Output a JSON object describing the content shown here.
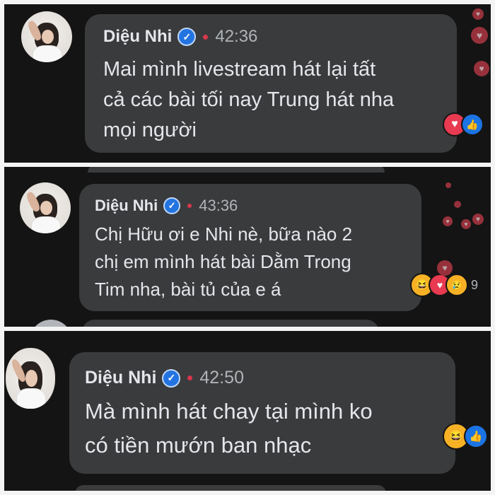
{
  "comments": [
    {
      "name": "Diệu Nhi",
      "verified_icon": "verified-badge-icon",
      "time": "42:36",
      "lines": [
        "Mai mình livestream hát lại tất",
        "cả các bài tối nay Trung hát nha",
        "mọi người"
      ],
      "reactions": [
        "love",
        "like"
      ]
    },
    {
      "name": "Diệu Nhi",
      "verified_icon": "verified-badge-icon",
      "time": "43:36",
      "lines": [
        "Chị Hữu ơi e Nhi nè, bữa nào 2",
        "chị em mình hát bài Dằm Trong",
        "Tim nha, bài tủ của e á"
      ],
      "reactions": [
        "haha",
        "love",
        "sad"
      ],
      "reaction_count": "9"
    },
    {
      "name": "Diệu Nhi",
      "verified_icon": "verified-badge-icon",
      "time": "42:50",
      "lines": [
        "Mà mình hát chay tại mình ko",
        "có tiền mướn ban nhạc"
      ],
      "reactions": [
        "haha",
        "like"
      ]
    }
  ],
  "colors": {
    "background": "#141414",
    "bubble": "#3a3b3c",
    "text": "#e4e6eb",
    "meta": "#b0b3b8",
    "verified": "#2374e1",
    "live_dot": "#d9364c",
    "love": "#e83a50",
    "like": "#1b74e4",
    "haha": "#f7b125"
  },
  "icons": {
    "love": "heart-icon",
    "like": "thumbs-up-icon",
    "haha": "laughing-emoji-icon",
    "sad": "sad-emoji-icon",
    "floating": "floating-heart-icon"
  }
}
